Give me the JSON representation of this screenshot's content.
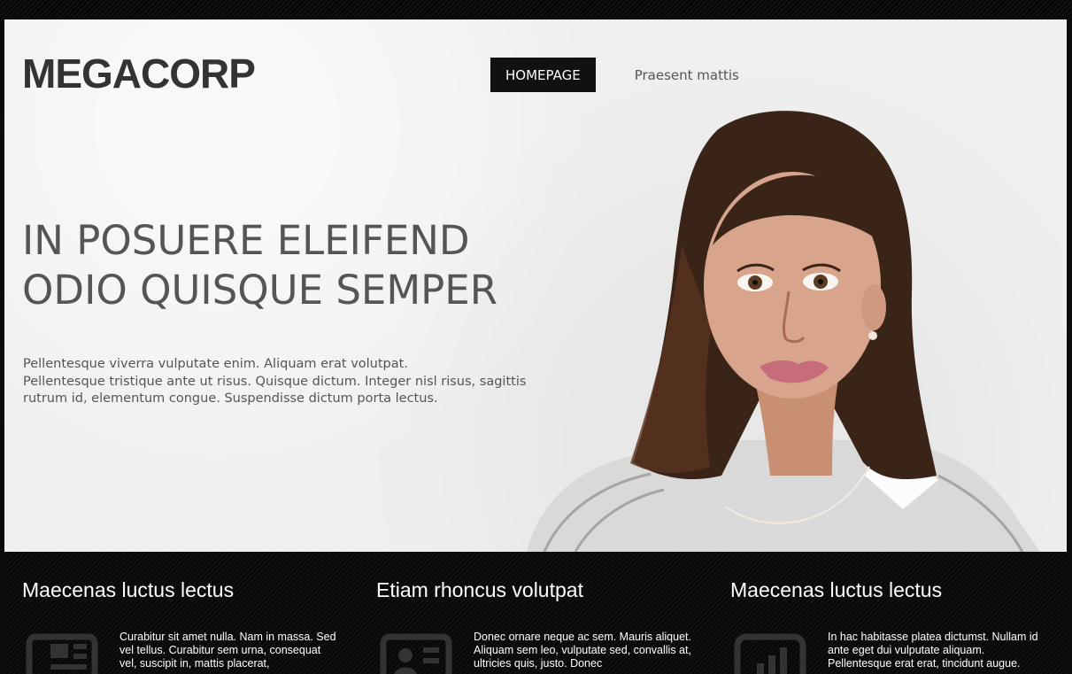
{
  "brand": {
    "logo": "MEGACORP"
  },
  "nav": {
    "items": [
      "HOMEPAGE",
      "Praesent mattis"
    ]
  },
  "hero": {
    "headline_line1": "IN POSUERE ELEIFEND",
    "headline_line2": "ODIO QUISQUE SEMPER",
    "intro_line1": "Pellentesque viverra vulputate enim. Aliquam erat volutpat.",
    "intro_line2": "Pellentesque tristique ante ut risus. Quisque dictum. Integer nisl risus, sagittis",
    "intro_line3": "rutrum id, elementum congue. Suspendisse dictum porta lectus."
  },
  "features": [
    {
      "title": "Maecenas luctus lectus",
      "text": "Curabitur sit amet nulla. Nam in massa. Sed vel tellus. Curabitur sem urna, consequat vel, suscipit in, mattis placerat,",
      "icon": "newspaper-icon"
    },
    {
      "title": "Etiam rhoncus volutpat",
      "text": "Donec ornare neque ac sem. Mauris aliquet. Aliquam sem leo, vulputate sed, convallis at, ultricies quis, justo. Donec",
      "icon": "contact-card-icon"
    },
    {
      "title": "Maecenas luctus lectus",
      "text": "In hac habitasse platea dictumst. Nullam id ante eget dui vulputate aliquam. Pellentesque erat erat, tincidunt augue.",
      "icon": "bar-chart-icon"
    }
  ],
  "colors": {
    "page_background": "#000000",
    "hero_background": "#efefef",
    "logo": "#333333",
    "nav_active_background": "#111111",
    "nav_active_text": "#ffffff",
    "headline": "#555555",
    "feature_text": "#ffffff"
  }
}
